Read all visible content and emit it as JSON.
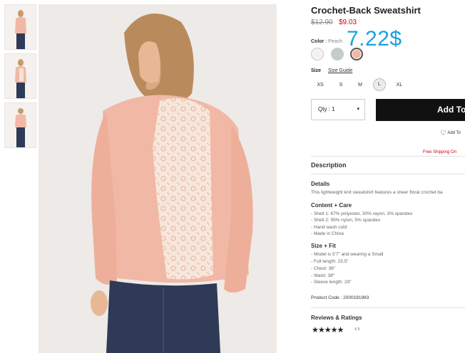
{
  "product": {
    "title": "Crochet-Back Sweatshirt",
    "price_original": "$12.90",
    "price_sale": "$9.03",
    "overlay_price": "7.22$"
  },
  "color": {
    "label": "Color",
    "separator": ":",
    "selected": "Peach",
    "swatches": [
      {
        "name": "cream",
        "hex": "#f5f3ef"
      },
      {
        "name": "sage",
        "hex": "#c4cdc7"
      },
      {
        "name": "peach",
        "hex": "#f1b8a5"
      }
    ]
  },
  "size": {
    "label": "Size",
    "guide": "Size Guide",
    "options": [
      "XS",
      "S",
      "M",
      "L",
      "XL"
    ],
    "selected": "L"
  },
  "qty": {
    "label": "Qty : 1",
    "caret": "▾"
  },
  "add_to_bag": "Add To",
  "wishlist": {
    "label": "Add To"
  },
  "shipping": "Free Shipping On",
  "description": {
    "title": "Description",
    "details_title": "Details",
    "details_text": "This lightweight knit sweatshirt features a sheer floral crochet ba",
    "content_title": "Content + Care",
    "content_lines": [
      "- Shell 1: 67% polyester, 30% rayon, 3% spandex",
      "- Shell 2: 95% nylon, 5% spandex",
      "- Hand wash cold",
      "- Made in China"
    ],
    "fit_title": "Size + Fit",
    "fit_lines": [
      "- Model is 5'7\" and wearing a Small",
      "- Full length: 23.5\"",
      "- Chest: 38\"",
      "- Waist: 38\"",
      "- Sleeve length: 29\""
    ],
    "product_code": "Product Code : 2000181983"
  },
  "reviews": {
    "title": "Reviews & Ratings",
    "stars": "★★★★★",
    "rating": "4.5"
  }
}
